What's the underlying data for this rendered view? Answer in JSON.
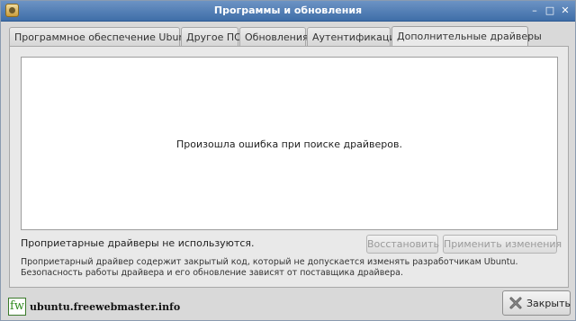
{
  "window": {
    "title": "Программы и обновления",
    "app_icon": "software-properties-icon",
    "controls": [
      "minimize-icon",
      "maximize-icon",
      "close-icon"
    ]
  },
  "tabs": [
    {
      "label": "Программное обеспечение Ubuntu",
      "active": false
    },
    {
      "label": "Другое ПО",
      "active": false
    },
    {
      "label": "Обновления",
      "active": false
    },
    {
      "label": "Аутентификация",
      "active": false
    },
    {
      "label": "Дополнительные драйверы",
      "active": true
    }
  ],
  "drivers": {
    "error_message": "Произошла ошибка при поиске драйверов.",
    "status": "Проприетарные драйверы не используются.",
    "restore_label": "Восстановить",
    "apply_label": "Применить изменения",
    "description": "Проприетарный драйвер содержит закрытый код, который не допускается изменять разработчикам Ubuntu. Безопасность работы драйвера и его обновление зависят от поставщика драйвера."
  },
  "footer": {
    "close_label": "Закрыть",
    "watermark_logo": "fw",
    "watermark_text": "ubuntu.freewebmaster.info"
  }
}
